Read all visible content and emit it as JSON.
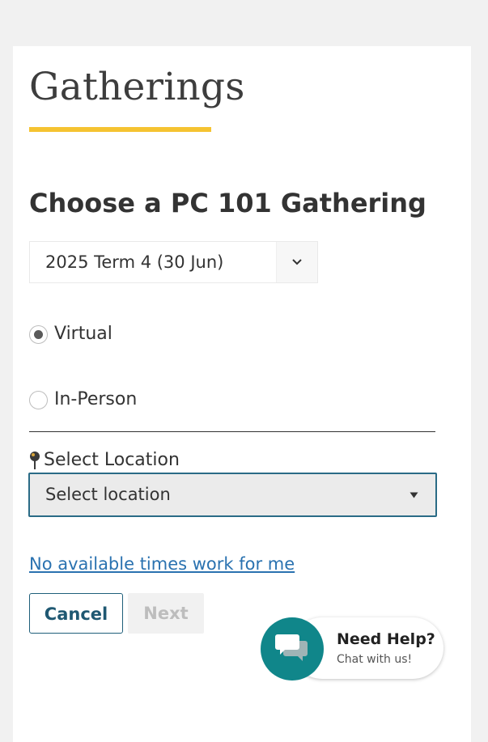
{
  "page": {
    "title": "Gatherings"
  },
  "form": {
    "heading": "Choose a PC 101 Gathering",
    "term_select": {
      "value": "2025 Term 4 (30 Jun)"
    },
    "format_options": [
      {
        "label": "Virtual",
        "checked": true
      },
      {
        "label": "In-Person",
        "checked": false
      }
    ],
    "location": {
      "label": "Select Location",
      "value": "Select location"
    },
    "no_times_link": "No available times work for me",
    "cancel_label": "Cancel",
    "next_label": "Next"
  },
  "help": {
    "title": "Need Help?",
    "subtitle": "Chat with us!"
  },
  "colors": {
    "accent_underline": "#f5c331",
    "primary": "#1f5872",
    "link": "#2a72b0",
    "chat": "#10868a"
  },
  "icons": {
    "term_chevron": "chevron-down-icon",
    "location_caret": "caret-down-icon",
    "location_pin": "map-pin-icon",
    "chat": "chat-bubbles-icon"
  }
}
